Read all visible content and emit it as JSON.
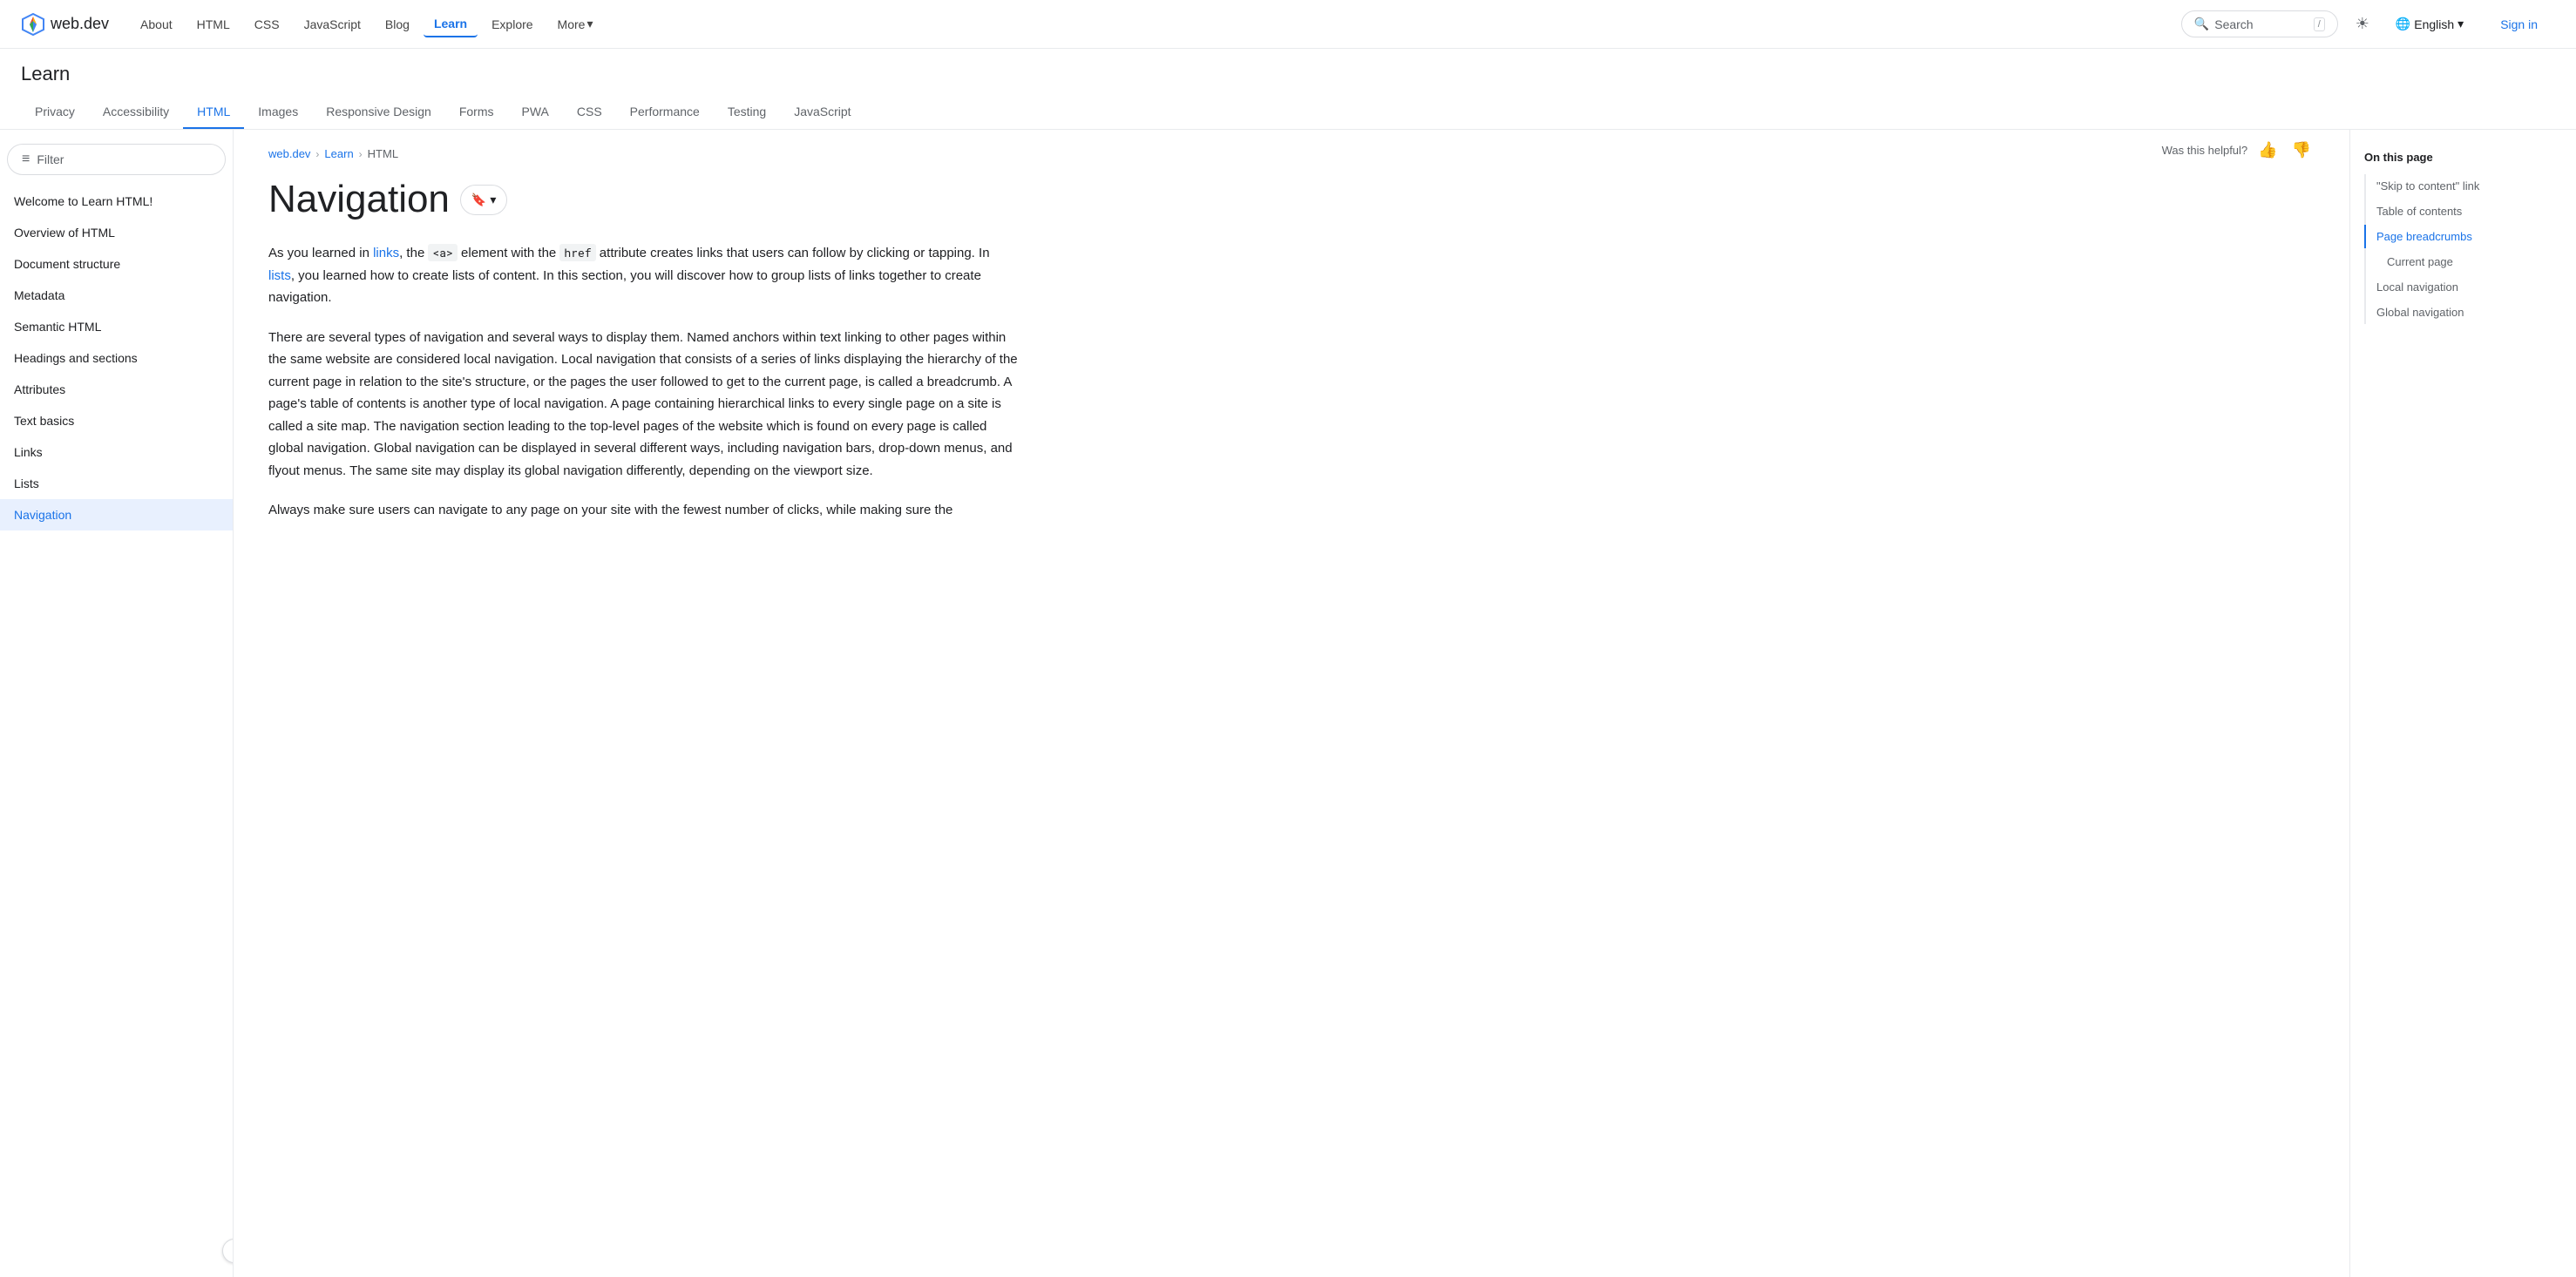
{
  "logo": {
    "text": "web.dev",
    "icon": "🚀"
  },
  "nav": {
    "links": [
      {
        "label": "About",
        "active": false
      },
      {
        "label": "HTML",
        "active": false
      },
      {
        "label": "CSS",
        "active": false
      },
      {
        "label": "JavaScript",
        "active": false
      },
      {
        "label": "Blog",
        "active": false
      },
      {
        "label": "Learn",
        "active": true
      },
      {
        "label": "Explore",
        "active": false
      },
      {
        "label": "More",
        "active": false,
        "dropdown": true
      }
    ],
    "search_placeholder": "Search",
    "search_shortcut": "/",
    "theme_icon": "☀",
    "language": "English",
    "sign_in": "Sign in"
  },
  "learn_section": {
    "title": "Learn",
    "tabs": [
      {
        "label": "Privacy",
        "active": false
      },
      {
        "label": "Accessibility",
        "active": false
      },
      {
        "label": "HTML",
        "active": true
      },
      {
        "label": "Images",
        "active": false
      },
      {
        "label": "Responsive Design",
        "active": false
      },
      {
        "label": "Forms",
        "active": false
      },
      {
        "label": "PWA",
        "active": false
      },
      {
        "label": "CSS",
        "active": false
      },
      {
        "label": "Performance",
        "active": false
      },
      {
        "label": "Testing",
        "active": false
      },
      {
        "label": "JavaScript",
        "active": false
      }
    ]
  },
  "sidebar": {
    "filter_placeholder": "Filter",
    "items": [
      {
        "label": "Welcome to Learn HTML!",
        "active": false
      },
      {
        "label": "Overview of HTML",
        "active": false
      },
      {
        "label": "Document structure",
        "active": false
      },
      {
        "label": "Metadata",
        "active": false
      },
      {
        "label": "Semantic HTML",
        "active": false
      },
      {
        "label": "Headings and sections",
        "active": false
      },
      {
        "label": "Attributes",
        "active": false
      },
      {
        "label": "Text basics",
        "active": false
      },
      {
        "label": "Links",
        "active": false
      },
      {
        "label": "Lists",
        "active": false
      },
      {
        "label": "Navigation",
        "active": true
      }
    ],
    "collapse_icon": "‹"
  },
  "breadcrumb": {
    "items": [
      {
        "label": "web.dev",
        "link": true
      },
      {
        "label": "Learn",
        "link": true
      },
      {
        "label": "HTML",
        "link": false
      }
    ],
    "separator": "›"
  },
  "helpful": {
    "label": "Was this helpful?",
    "thumbup": "👍",
    "thumbdown": "👎"
  },
  "article": {
    "title": "Navigation",
    "bookmark_icon": "🔖",
    "bookmark_dropdown": "▾",
    "paragraphs": [
      "As you learned in links, the <a> element with the href attribute creates links that users can follow by clicking or tapping. In lists, you learned how to create lists of content. In this section, you will discover how to group lists of links together to create navigation.",
      "There are several types of navigation and several ways to display them. Named anchors within text linking to other pages within the same website are considered local navigation. Local navigation that consists of a series of links displaying the hierarchy of the current page in relation to the site's structure, or the pages the user followed to get to the current page, is called a breadcrumb. A page's table of contents is another type of local navigation. A page containing hierarchical links to every single page on a site is called a site map. The navigation section leading to the top-level pages of the website which is found on every page is called global navigation. Global navigation can be displayed in several different ways, including navigation bars, drop-down menus, and flyout menus. The same site may display its global navigation differently, depending on the viewport size.",
      "Always make sure users can navigate to any page on your site with the fewest number of clicks, while making sure the"
    ]
  },
  "toc": {
    "title": "On this page",
    "items": [
      {
        "label": "\"Skip to content\" link",
        "active": false,
        "sub": false
      },
      {
        "label": "Table of contents",
        "active": false,
        "sub": false
      },
      {
        "label": "Page breadcrumbs",
        "active": true,
        "sub": false
      },
      {
        "label": "Current page",
        "active": false,
        "sub": true
      },
      {
        "label": "Local navigation",
        "active": false,
        "sub": false
      },
      {
        "label": "Global navigation",
        "active": false,
        "sub": false
      }
    ]
  },
  "colors": {
    "accent": "#1a73e8",
    "border": "#e8eaed",
    "active_bg": "#e8f0fe"
  }
}
